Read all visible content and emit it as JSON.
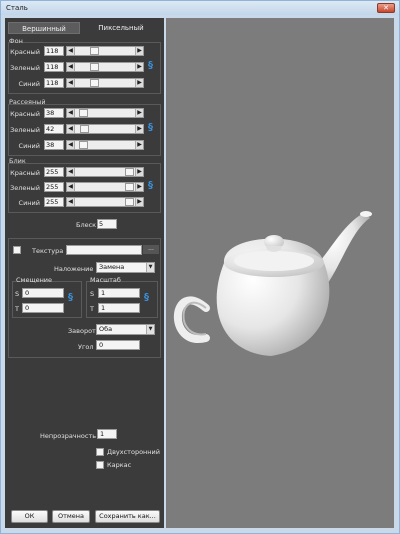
{
  "window": {
    "title": "Сталь",
    "close_glyph": "✕"
  },
  "tabs": [
    {
      "label": "Вершинный"
    },
    {
      "label": "Пиксельный"
    }
  ],
  "groups": {
    "background": {
      "title": "Фон",
      "rows": [
        {
          "label": "Красный",
          "value": "118"
        },
        {
          "label": "Зеленый",
          "value": "118"
        },
        {
          "label": "Синий",
          "value": "118"
        }
      ]
    },
    "diffuse": {
      "title": "Рассеяный",
      "rows": [
        {
          "label": "Красный",
          "value": "38"
        },
        {
          "label": "Зеленый",
          "value": "42"
        },
        {
          "label": "Синий",
          "value": "38"
        }
      ]
    },
    "specular": {
      "title": "Блик",
      "rows": [
        {
          "label": "Красный",
          "value": "255"
        },
        {
          "label": "Зеленый",
          "value": "255"
        },
        {
          "label": "Синий",
          "value": "255"
        }
      ]
    }
  },
  "shininess": {
    "label": "Блеск",
    "value": "5"
  },
  "texture": {
    "label": "Текстура",
    "value": "",
    "browse_label": "...",
    "overlay": {
      "label": "Наложение",
      "value": "Замена"
    },
    "offset": {
      "title": "Смещение",
      "s_label": "S",
      "s_value": "0",
      "t_label": "T",
      "t_value": "0"
    },
    "scale": {
      "title": "Масштаб",
      "s_label": "S",
      "s_value": "1",
      "t_label": "T",
      "t_value": "1"
    },
    "wrap": {
      "label": "Заворот",
      "value": "Оба"
    },
    "angle": {
      "label": "Угол",
      "value": "0"
    }
  },
  "opacity": {
    "label": "Непрозрачность",
    "value": "1"
  },
  "two_sided": {
    "label": "Двухсторонний"
  },
  "wireframe": {
    "label": "Каркас"
  },
  "buttons": {
    "ok": "ОК",
    "cancel": "Отмена",
    "save_as": "Сохранить как..."
  },
  "icons": {
    "arrow_left": "◀",
    "arrow_right": "▶",
    "dropdown": "▼",
    "link": "§"
  },
  "colors": {
    "panel": "#3b3b3b",
    "viewport": "#7c7c7c",
    "link_icon": "#3a8fd8"
  }
}
